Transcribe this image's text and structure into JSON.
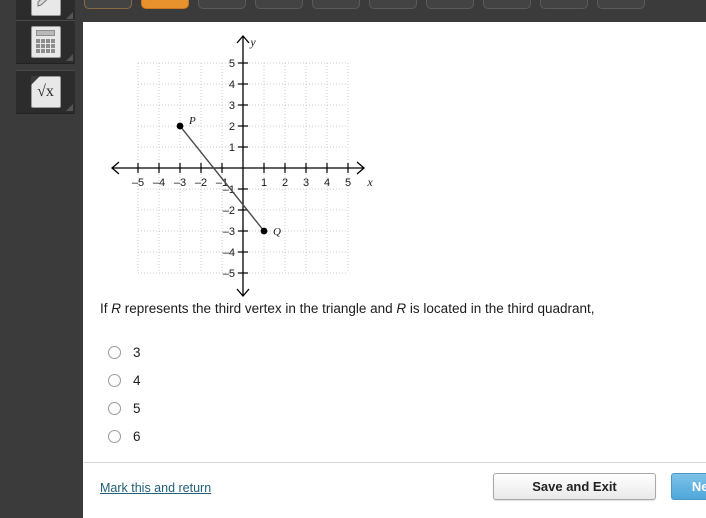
{
  "toolbar": {
    "pager": [
      {
        "state": "visited"
      },
      {
        "state": "current"
      },
      {
        "state": "upcoming"
      },
      {
        "state": "upcoming"
      },
      {
        "state": "upcoming"
      },
      {
        "state": "upcoming"
      },
      {
        "state": "upcoming"
      },
      {
        "state": "upcoming"
      },
      {
        "state": "upcoming"
      },
      {
        "state": "upcoming"
      }
    ],
    "current_color": "#e8922e",
    "background_color": "#3b3b3b"
  },
  "sidebar": {
    "tools": [
      {
        "icon": "pencil-icon",
        "label": "Pencil"
      },
      {
        "icon": "calculator-icon",
        "label": "Calculator"
      },
      {
        "icon": "formula-sqrt-icon",
        "label": "Formula"
      }
    ],
    "sqrt_glyph": "√x"
  },
  "question": {
    "text_part_1": "If ",
    "var_r_1": "R",
    "text_part_2": " represents the third vertex in the triangle and ",
    "var_r_2": "R",
    "text_part_3": " is located in the third quadrant,",
    "options": [
      {
        "label": "3",
        "selected": false
      },
      {
        "label": "4",
        "selected": false
      },
      {
        "label": "5",
        "selected": false
      },
      {
        "label": "6",
        "selected": false
      }
    ]
  },
  "chart_data": {
    "type": "scatter",
    "title": "",
    "xlabel": "x",
    "ylabel": "y",
    "xlim": [
      -5,
      5
    ],
    "ylim": [
      -5,
      5
    ],
    "xticks": [
      -5,
      -4,
      -3,
      -2,
      -1,
      1,
      2,
      3,
      4,
      5
    ],
    "yticks": [
      -5,
      -4,
      -3,
      -2,
      -1,
      1,
      2,
      3,
      4,
      5
    ],
    "xtick_labels": [
      "–5",
      "–4",
      "–3",
      "–2",
      "–1",
      "1",
      "2",
      "3",
      "4",
      "5"
    ],
    "ytick_labels": [
      "–5",
      "–4",
      "–3",
      "–2",
      "–1",
      "1",
      "2",
      "3",
      "4",
      "5"
    ],
    "grid": true,
    "legend": "none",
    "points": [
      {
        "name": "P",
        "x": -3,
        "y": 2
      },
      {
        "name": "Q",
        "x": 1,
        "y": -3
      }
    ],
    "segments": [
      {
        "from": "P",
        "to": "Q",
        "x1": -3,
        "y1": 2,
        "x2": 1,
        "y2": -3
      }
    ],
    "axis_arrows": true
  },
  "footer": {
    "mark_return_label": "Mark this and return",
    "save_exit_label": "Save and Exit",
    "next_label": "Next",
    "link_color": "#21607a",
    "next_color": "#5badde"
  }
}
